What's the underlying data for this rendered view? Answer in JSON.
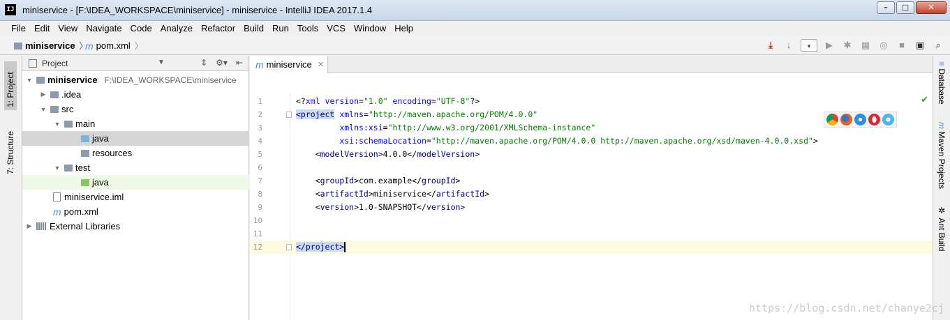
{
  "window": {
    "title": "miniservice - [F:\\IDEA_WORKSPACE\\miniservice] - miniservice - IntelliJ IDEA 2017.1.4",
    "app_icon": "IJ"
  },
  "menu": [
    "File",
    "Edit",
    "View",
    "Navigate",
    "Code",
    "Analyze",
    "Refactor",
    "Build",
    "Run",
    "Tools",
    "VCS",
    "Window",
    "Help"
  ],
  "breadcrumb": {
    "project": "miniservice",
    "file": "pom.xml"
  },
  "left_tabs": {
    "project": "1: Project",
    "structure": "7: Structure"
  },
  "project_panel": {
    "header": "Project",
    "tree": [
      {
        "label": "miniservice",
        "path": "F:\\IDEA_WORKSPACE\\miniservice"
      },
      {
        "label": ".idea"
      },
      {
        "label": "src"
      },
      {
        "label": "main"
      },
      {
        "label": "java"
      },
      {
        "label": "resources"
      },
      {
        "label": "test"
      },
      {
        "label": "java"
      },
      {
        "label": "miniservice.iml"
      },
      {
        "label": "pom.xml"
      },
      {
        "label": "External Libraries"
      }
    ]
  },
  "editor": {
    "tab_label": "miniservice",
    "lines": [
      {
        "n": "1",
        "parts": [
          [
            "t",
            "<?"
          ],
          [
            "a",
            "xml version"
          ],
          [
            "t",
            "="
          ],
          [
            "s",
            "\"1.0\""
          ],
          [
            "a",
            " encoding"
          ],
          [
            "t",
            "="
          ],
          [
            "s",
            "\"UTF-8\""
          ],
          [
            "t",
            "?>"
          ]
        ]
      },
      {
        "n": "2",
        "parts": [
          [
            "h",
            "<project"
          ],
          [
            "t",
            " "
          ],
          [
            "a",
            "xmlns"
          ],
          [
            "t",
            "="
          ],
          [
            "s",
            "\"http://maven.apache.org/POM/4.0.0\""
          ]
        ]
      },
      {
        "n": "3",
        "parts": [
          [
            "t",
            "         "
          ],
          [
            "a",
            "xmlns:xsi"
          ],
          [
            "t",
            "="
          ],
          [
            "s",
            "\"http://www.w3.org/2001/XMLSchema-instance\""
          ]
        ]
      },
      {
        "n": "4",
        "parts": [
          [
            "t",
            "         "
          ],
          [
            "a",
            "xsi:schemaLocation"
          ],
          [
            "t",
            "="
          ],
          [
            "s",
            "\"http://maven.apache.org/POM/4.0.0 http://maven.apache.org/xsd/maven-4.0.0.xsd\""
          ],
          [
            "t",
            ">"
          ]
        ]
      },
      {
        "n": "5",
        "parts": [
          [
            "t",
            "    <"
          ],
          [
            "g",
            "modelVersion"
          ],
          [
            "t",
            ">4.0.0</"
          ],
          [
            "g",
            "modelVersion"
          ],
          [
            "t",
            ">"
          ]
        ]
      },
      {
        "n": "6",
        "parts": []
      },
      {
        "n": "7",
        "parts": [
          [
            "t",
            "    <"
          ],
          [
            "g",
            "groupId"
          ],
          [
            "t",
            ">com.example</"
          ],
          [
            "g",
            "groupId"
          ],
          [
            "t",
            ">"
          ]
        ]
      },
      {
        "n": "8",
        "parts": [
          [
            "t",
            "    <"
          ],
          [
            "g",
            "artifactId"
          ],
          [
            "t",
            ">miniservice</"
          ],
          [
            "g",
            "artifactId"
          ],
          [
            "t",
            ">"
          ]
        ]
      },
      {
        "n": "9",
        "parts": [
          [
            "t",
            "    <"
          ],
          [
            "g",
            "version"
          ],
          [
            "t",
            ">1.0-SNAPSHOT</"
          ],
          [
            "g",
            "version"
          ],
          [
            "t",
            ">"
          ]
        ]
      },
      {
        "n": "10",
        "parts": []
      },
      {
        "n": "11",
        "parts": []
      },
      {
        "n": "12",
        "parts": [
          [
            "h",
            "</project>"
          ]
        ]
      }
    ]
  },
  "right_tabs": {
    "database": "Database",
    "maven": "Maven Projects",
    "ant": "Ant Build"
  },
  "watermark": "https://blog.csdn.net/chanye2cj",
  "colors": {
    "tag": "#000080",
    "attr": "#0000ff",
    "string": "#008000",
    "selection": "#c9dbef"
  }
}
